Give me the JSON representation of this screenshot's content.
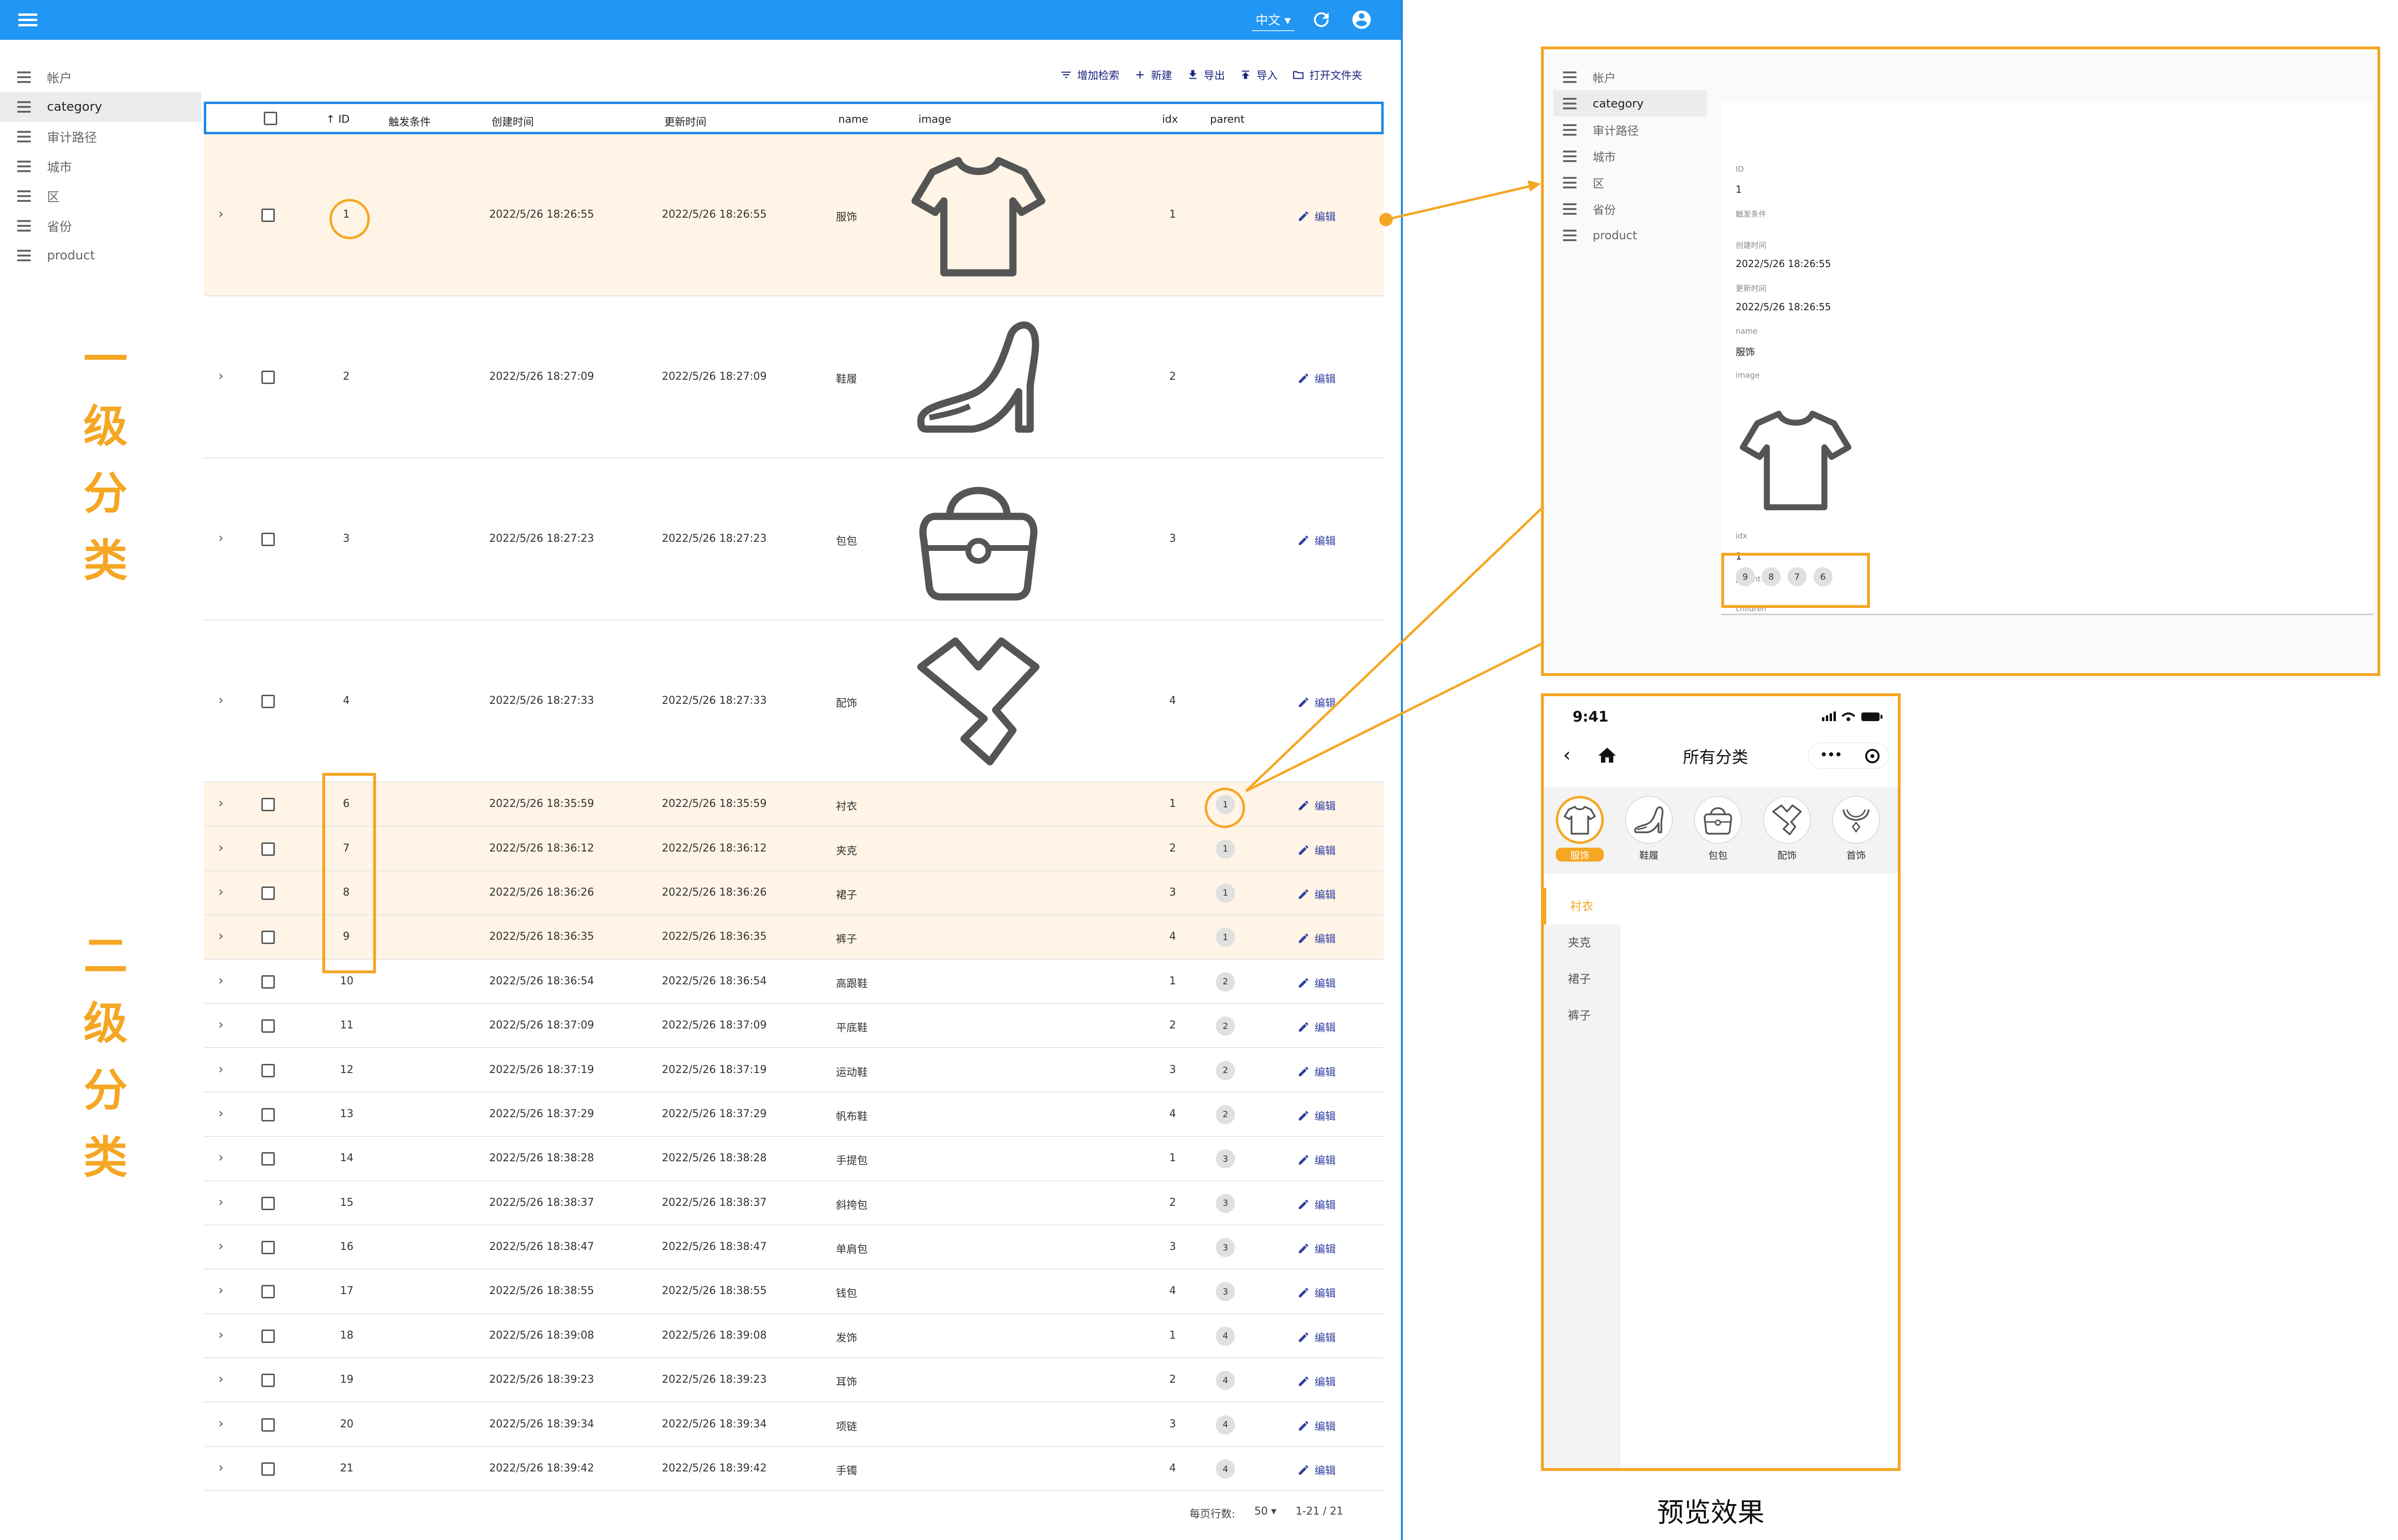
{
  "app": {
    "language": "中文",
    "menu_icon": "hamburger-icon",
    "refresh_icon": "refresh-icon",
    "account_icon": "account-circle-icon"
  },
  "sidebar": {
    "items": [
      {
        "label": "帐户",
        "active": false
      },
      {
        "label": "category",
        "active": true
      },
      {
        "label": "审计路径",
        "active": false
      },
      {
        "label": "城市",
        "active": false
      },
      {
        "label": "区",
        "active": false
      },
      {
        "label": "省份",
        "active": false
      },
      {
        "label": "product",
        "active": false
      }
    ]
  },
  "annotations": {
    "level1": "一级分类",
    "level2": "二级分类",
    "preview_caption": "预览效果",
    "accent_color": "#f5a623"
  },
  "toolbar": {
    "filter": "增加检索",
    "create": "新建",
    "export": "导出",
    "import": "导入",
    "open_folder": "打开文件夹"
  },
  "table": {
    "headers": {
      "sort_arrow": "↑",
      "id": "ID",
      "trigger": "触发条件",
      "created": "创建时间",
      "updated": "更新时间",
      "name": "name",
      "image": "image",
      "idx": "idx",
      "parent": "parent"
    },
    "edit_label": "编辑",
    "top_rows": [
      {
        "id": "1",
        "created": "2022/5/26 18:26:55",
        "updated": "2022/5/26 18:26:55",
        "name": "服饰",
        "idx": "1",
        "icon": "tshirt-icon",
        "highlight": true
      },
      {
        "id": "2",
        "created": "2022/5/26 18:27:09",
        "updated": "2022/5/26 18:27:09",
        "name": "鞋履",
        "idx": "2",
        "icon": "high-heel-icon",
        "highlight": false
      },
      {
        "id": "3",
        "created": "2022/5/26 18:27:23",
        "updated": "2022/5/26 18:27:23",
        "name": "包包",
        "idx": "3",
        "icon": "handbag-icon",
        "highlight": false
      },
      {
        "id": "4",
        "created": "2022/5/26 18:27:33",
        "updated": "2022/5/26 18:27:33",
        "name": "配饰",
        "idx": "4",
        "icon": "scarf-icon",
        "highlight": false
      }
    ],
    "sub_rows": [
      {
        "id": "6",
        "created": "2022/5/26 18:35:59",
        "updated": "2022/5/26 18:35:59",
        "name": "衬衣",
        "idx": "1",
        "parent": "1",
        "highlight": true
      },
      {
        "id": "7",
        "created": "2022/5/26 18:36:12",
        "updated": "2022/5/26 18:36:12",
        "name": "夹克",
        "idx": "2",
        "parent": "1",
        "highlight": true
      },
      {
        "id": "8",
        "created": "2022/5/26 18:36:26",
        "updated": "2022/5/26 18:36:26",
        "name": "裙子",
        "idx": "3",
        "parent": "1",
        "highlight": true
      },
      {
        "id": "9",
        "created": "2022/5/26 18:36:35",
        "updated": "2022/5/26 18:36:35",
        "name": "裤子",
        "idx": "4",
        "parent": "1",
        "highlight": true
      },
      {
        "id": "10",
        "created": "2022/5/26 18:36:54",
        "updated": "2022/5/26 18:36:54",
        "name": "高跟鞋",
        "idx": "1",
        "parent": "2",
        "highlight": false
      },
      {
        "id": "11",
        "created": "2022/5/26 18:37:09",
        "updated": "2022/5/26 18:37:09",
        "name": "平底鞋",
        "idx": "2",
        "parent": "2",
        "highlight": false
      },
      {
        "id": "12",
        "created": "2022/5/26 18:37:19",
        "updated": "2022/5/26 18:37:19",
        "name": "运动鞋",
        "idx": "3",
        "parent": "2",
        "highlight": false
      },
      {
        "id": "13",
        "created": "2022/5/26 18:37:29",
        "updated": "2022/5/26 18:37:29",
        "name": "帆布鞋",
        "idx": "4",
        "parent": "2",
        "highlight": false
      },
      {
        "id": "14",
        "created": "2022/5/26 18:38:28",
        "updated": "2022/5/26 18:38:28",
        "name": "手提包",
        "idx": "1",
        "parent": "3",
        "highlight": false
      },
      {
        "id": "15",
        "created": "2022/5/26 18:38:37",
        "updated": "2022/5/26 18:38:37",
        "name": "斜挎包",
        "idx": "2",
        "parent": "3",
        "highlight": false
      },
      {
        "id": "16",
        "created": "2022/5/26 18:38:47",
        "updated": "2022/5/26 18:38:47",
        "name": "单肩包",
        "idx": "3",
        "parent": "3",
        "highlight": false
      },
      {
        "id": "17",
        "created": "2022/5/26 18:38:55",
        "updated": "2022/5/26 18:38:55",
        "name": "钱包",
        "idx": "4",
        "parent": "3",
        "highlight": false
      },
      {
        "id": "18",
        "created": "2022/5/26 18:39:08",
        "updated": "2022/5/26 18:39:08",
        "name": "发饰",
        "idx": "1",
        "parent": "4",
        "highlight": false
      },
      {
        "id": "19",
        "created": "2022/5/26 18:39:23",
        "updated": "2022/5/26 18:39:23",
        "name": "耳饰",
        "idx": "2",
        "parent": "4",
        "highlight": false
      },
      {
        "id": "20",
        "created": "2022/5/26 18:39:34",
        "updated": "2022/5/26 18:39:34",
        "name": "项链",
        "idx": "3",
        "parent": "4",
        "highlight": false
      },
      {
        "id": "21",
        "created": "2022/5/26 18:39:42",
        "updated": "2022/5/26 18:39:42",
        "name": "手镯",
        "idx": "4",
        "parent": "4",
        "highlight": false
      }
    ],
    "footer": {
      "rows_per_page_label": "每页行数:",
      "rows_per_page": "50",
      "range": "1-21 / 21"
    }
  },
  "detail": {
    "sidebar": [
      "帐户",
      "category",
      "审计路径",
      "城市",
      "区",
      "省份",
      "product"
    ],
    "fields": {
      "id_label": "ID",
      "id_value": "1",
      "trigger_label": "触发条件",
      "created_label": "创建时间",
      "created_value": "2022/5/26 18:26:55",
      "updated_label": "更新时间",
      "updated_value": "2022/5/26 18:26:55",
      "name_label": "name",
      "name_value": "服饰",
      "image_label": "image",
      "idx_label": "idx",
      "idx_value": "1",
      "parent_label": "parent",
      "children_label": "children",
      "children": [
        "9",
        "8",
        "7",
        "6"
      ]
    }
  },
  "phone": {
    "time": "9:41",
    "title": "所有分类",
    "more": "•••",
    "categories": [
      {
        "label": "服饰",
        "icon": "tshirt-icon",
        "active": true
      },
      {
        "label": "鞋履",
        "icon": "high-heel-icon",
        "active": false
      },
      {
        "label": "包包",
        "icon": "handbag-icon",
        "active": false
      },
      {
        "label": "配饰",
        "icon": "scarf-icon",
        "active": false
      },
      {
        "label": "首饰",
        "icon": "necklace-icon",
        "active": false
      }
    ],
    "subcategories": [
      {
        "label": "衬衣",
        "active": true
      },
      {
        "label": "夹克",
        "active": false
      },
      {
        "label": "裙子",
        "active": false
      },
      {
        "label": "裤子",
        "active": false
      }
    ]
  }
}
